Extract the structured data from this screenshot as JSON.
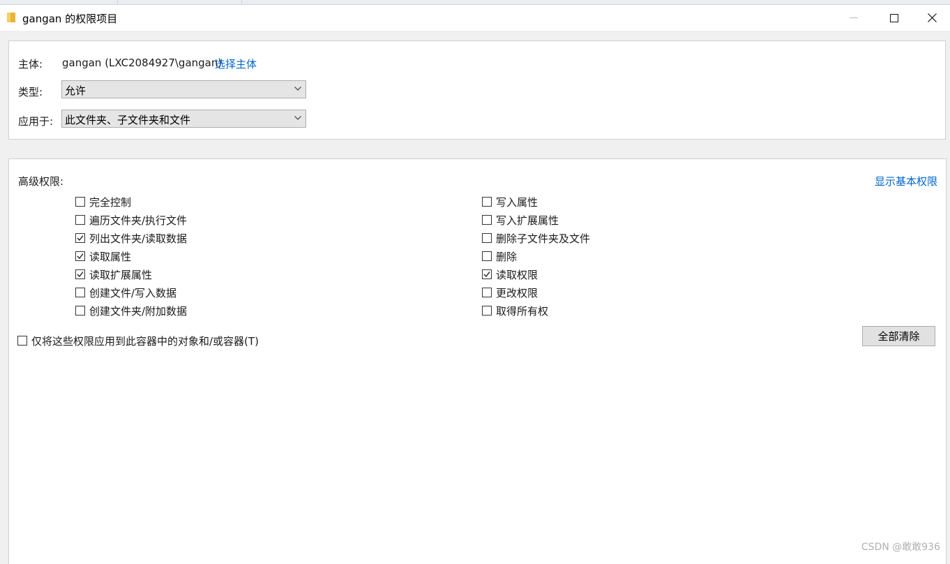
{
  "window": {
    "title": "gangan 的权限项目"
  },
  "principal": {
    "label": "主体:",
    "value": "gangan (LXC2084927\\gangan)",
    "link": "选择主体"
  },
  "type": {
    "label": "类型:",
    "value": "允许"
  },
  "applies_to": {
    "label": "应用于:",
    "value": "此文件夹、子文件夹和文件"
  },
  "advanced": {
    "heading": "高级权限:",
    "show_basic_link": "显示基本权限",
    "left": [
      {
        "label": "完全控制",
        "checked": false
      },
      {
        "label": "遍历文件夹/执行文件",
        "checked": false
      },
      {
        "label": "列出文件夹/读取数据",
        "checked": true
      },
      {
        "label": "读取属性",
        "checked": true
      },
      {
        "label": "读取扩展属性",
        "checked": true
      },
      {
        "label": "创建文件/写入数据",
        "checked": false
      },
      {
        "label": "创建文件夹/附加数据",
        "checked": false
      }
    ],
    "right": [
      {
        "label": "写入属性",
        "checked": false
      },
      {
        "label": "写入扩展属性",
        "checked": false
      },
      {
        "label": "删除子文件夹及文件",
        "checked": false
      },
      {
        "label": "删除",
        "checked": false
      },
      {
        "label": "读取权限",
        "checked": true
      },
      {
        "label": "更改权限",
        "checked": false
      },
      {
        "label": "取得所有权",
        "checked": false
      }
    ]
  },
  "apply_only": {
    "label": "仅将这些权限应用到此容器中的对象和/或容器(T)",
    "checked": false
  },
  "clear_all_button": "全部清除",
  "watermark": "CSDN @敢敢936",
  "icons": {
    "folder": "folder-icon",
    "minimize": "minimize-icon",
    "maximize": "maximize-icon",
    "close": "close-icon",
    "dropdown": "chevron-down-icon",
    "check": "check-icon"
  }
}
